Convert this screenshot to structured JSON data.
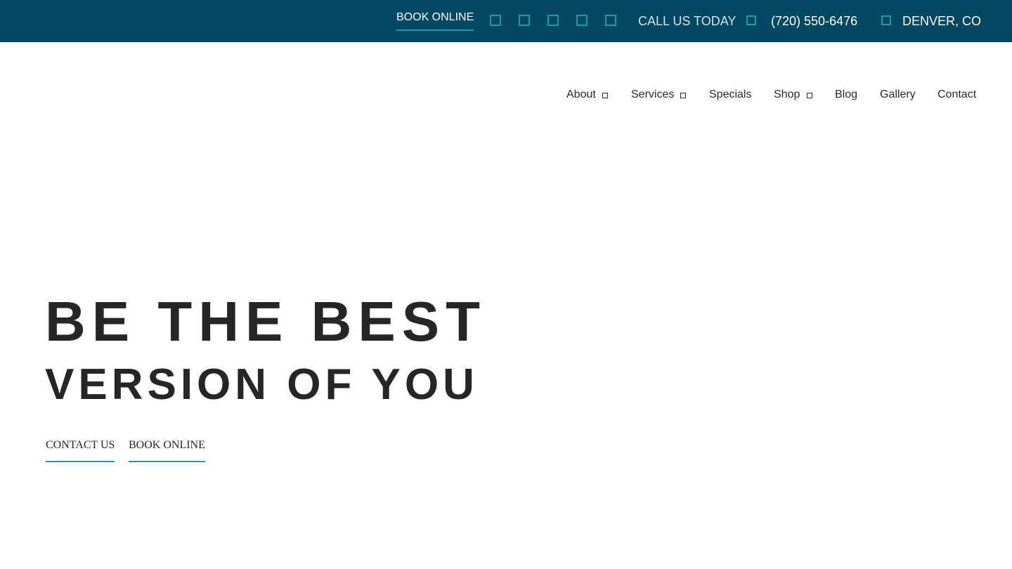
{
  "topbar": {
    "book_online_label": "BOOK ONLINE",
    "social_icons": [
      "facebook-icon",
      "instagram-icon",
      "twitter-icon",
      "youtube-icon",
      "pinterest-icon"
    ],
    "call_label": "CALL US TODAY",
    "phone_icon": "phone-icon",
    "phone": "(720) 550-6476",
    "location_icon": "map-pin-icon",
    "location": "DENVER, CO"
  },
  "nav": {
    "items": [
      {
        "label": "About",
        "has_dropdown": true
      },
      {
        "label": "Services",
        "has_dropdown": true
      },
      {
        "label": "Specials",
        "has_dropdown": false
      },
      {
        "label": "Shop",
        "has_dropdown": true
      },
      {
        "label": "Blog",
        "has_dropdown": false
      },
      {
        "label": "Gallery",
        "has_dropdown": false
      },
      {
        "label": "Contact",
        "has_dropdown": false
      }
    ]
  },
  "hero": {
    "headline_line1": "BE THE BEST",
    "headline_line2": "VERSION OF YOU",
    "contact_label": "CONTACT US",
    "book_label": "BOOK ONLINE"
  },
  "colors": {
    "topbar_bg": "#024862",
    "accent": "#1a9ba8",
    "text_dark": "#262626",
    "text_light": "#ffffff"
  }
}
